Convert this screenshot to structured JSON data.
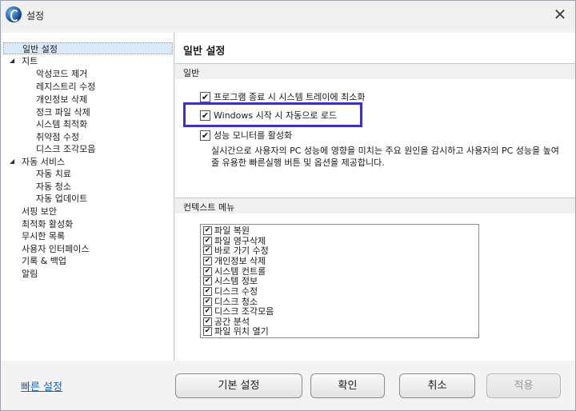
{
  "window": {
    "title": "설정",
    "close_symbol": "✕"
  },
  "sidebar": {
    "items": [
      {
        "label": "일반 설정",
        "selected": true
      },
      {
        "label": "지트",
        "toggle": "◢"
      },
      {
        "label": "악성코드 제거"
      },
      {
        "label": "레지스트리 수정"
      },
      {
        "label": "개인정보 삭제"
      },
      {
        "label": "정크 파일 삭제"
      },
      {
        "label": "시스템 최적화"
      },
      {
        "label": "취약점 수정"
      },
      {
        "label": "디스크 조각모음"
      },
      {
        "label": "자동 서비스",
        "toggle": "◢"
      },
      {
        "label": "자동 치료"
      },
      {
        "label": "자동 청소"
      },
      {
        "label": "자동 업데이트"
      },
      {
        "label": "서핑 보안"
      },
      {
        "label": "최적화 활성화"
      },
      {
        "label": "무시한 목록"
      },
      {
        "label": "사용자 인터페이스"
      },
      {
        "label": "기록 & 백업"
      },
      {
        "label": "알림"
      }
    ]
  },
  "main": {
    "title": "일반 설정",
    "general_section": "일반",
    "options": [
      {
        "label": "프로그램 종료 시 시스템 트레이에 최소화",
        "checked": true
      },
      {
        "label": "Windows 시작 시 자동으로 로드",
        "checked": true
      },
      {
        "label": "성능 모니터를 활성화",
        "checked": true
      }
    ],
    "perf_description": "실시간으로 사용자의 PC 성능에 영향을 미치는 주요 원인을 감시하고 사용자의 PC 성능을 높여줄 유용한 빠른실행 버튼 및 옵션을 제공합니다.",
    "context_section": "컨텍스트 메뉴",
    "context_items": [
      {
        "label": "파일 복원",
        "checked": true
      },
      {
        "label": "파일 영구삭제",
        "checked": true
      },
      {
        "label": "바로 가기 수정",
        "checked": true
      },
      {
        "label": "개인정보 삭제",
        "checked": true
      },
      {
        "label": "시스템 컨트롤",
        "checked": true
      },
      {
        "label": "시스템 정보",
        "checked": true
      },
      {
        "label": "디스크 수정",
        "checked": true
      },
      {
        "label": "디스크 청소",
        "checked": true
      },
      {
        "label": "디스크 조각모음",
        "checked": true
      },
      {
        "label": "공간 분석",
        "checked": true
      },
      {
        "label": "파일 위치 열기",
        "checked": true
      }
    ]
  },
  "footer": {
    "quick_settings_link": "빠른 설정",
    "default_button": "기본 설정",
    "ok_button": "확인",
    "cancel_button": "취소",
    "apply_button": "적용"
  },
  "colors": {
    "highlight_border": "#3a2fd6",
    "link": "#1667c3",
    "selected_item_bg": "#dbeaf8"
  },
  "check_glyph": "✔"
}
